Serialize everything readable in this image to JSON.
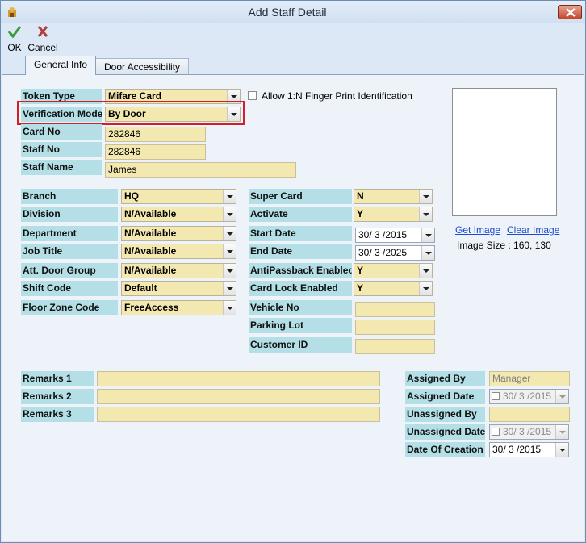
{
  "window": {
    "title": "Add Staff Detail"
  },
  "toolbar": {
    "ok_label": "OK",
    "cancel_label": "Cancel"
  },
  "tabs": [
    {
      "label": "General Info"
    },
    {
      "label": "Door Accessibility"
    }
  ],
  "form": {
    "token_type": {
      "label": "Token Type",
      "value": "Mifare Card"
    },
    "allow_fp": {
      "label": "Allow 1:N Finger Print Identification",
      "checked": false
    },
    "verification_mode": {
      "label": "Verification Mode",
      "value": "By Door"
    },
    "card_no": {
      "label": "Card No",
      "value": "282846"
    },
    "staff_no": {
      "label": "Staff No",
      "value": "282846"
    },
    "staff_name": {
      "label": "Staff Name",
      "value": "James"
    },
    "branch": {
      "label": "Branch",
      "value": "HQ"
    },
    "division": {
      "label": "Division",
      "value": "N/Available"
    },
    "department": {
      "label": "Department",
      "value": "N/Available"
    },
    "job_title": {
      "label": "Job Title",
      "value": "N/Available"
    },
    "att_door_group": {
      "label": "Att. Door Group",
      "value": "N/Available"
    },
    "shift_code": {
      "label": "Shift Code",
      "value": "Default"
    },
    "floor_zone_code": {
      "label": "Floor Zone Code",
      "value": "FreeAccess"
    },
    "super_card": {
      "label": "Super Card",
      "value": "N"
    },
    "activate": {
      "label": "Activate",
      "value": "Y"
    },
    "start_date": {
      "label": "Start Date",
      "value": "30/ 3 /2015"
    },
    "end_date": {
      "label": "End Date",
      "value": "30/ 3 /2025"
    },
    "antipassback": {
      "label": "AntiPassback Enabled",
      "value": "Y"
    },
    "card_lock": {
      "label": "Card Lock Enabled",
      "value": "Y"
    },
    "vehicle_no": {
      "label": "Vehicle No",
      "value": ""
    },
    "parking_lot": {
      "label": "Parking Lot",
      "value": ""
    },
    "customer_id": {
      "label": "Customer ID",
      "value": ""
    },
    "remarks1": {
      "label": "Remarks 1",
      "value": ""
    },
    "remarks2": {
      "label": "Remarks 2",
      "value": ""
    },
    "remarks3": {
      "label": "Remarks 3",
      "value": ""
    },
    "assigned_by": {
      "label": "Assigned By",
      "value": "Manager"
    },
    "assigned_date": {
      "label": "Assigned Date",
      "value": "30/ 3 /2015"
    },
    "unassigned_by": {
      "label": "Unassigned By",
      "value": ""
    },
    "unassigned_date": {
      "label": "Unassigned Date",
      "value": "30/ 3 /2015"
    },
    "date_of_creation": {
      "label": "Date Of Creation",
      "value": "30/ 3 /2015"
    }
  },
  "image": {
    "get_label": "Get Image",
    "clear_label": "Clear Image",
    "size_text": "Image Size : 160, 130"
  },
  "colors": {
    "label_bg": "#b4dfe6",
    "field_bg": "#f2e8b0",
    "highlight": "#d21f27",
    "link": "#1d4bd0"
  }
}
